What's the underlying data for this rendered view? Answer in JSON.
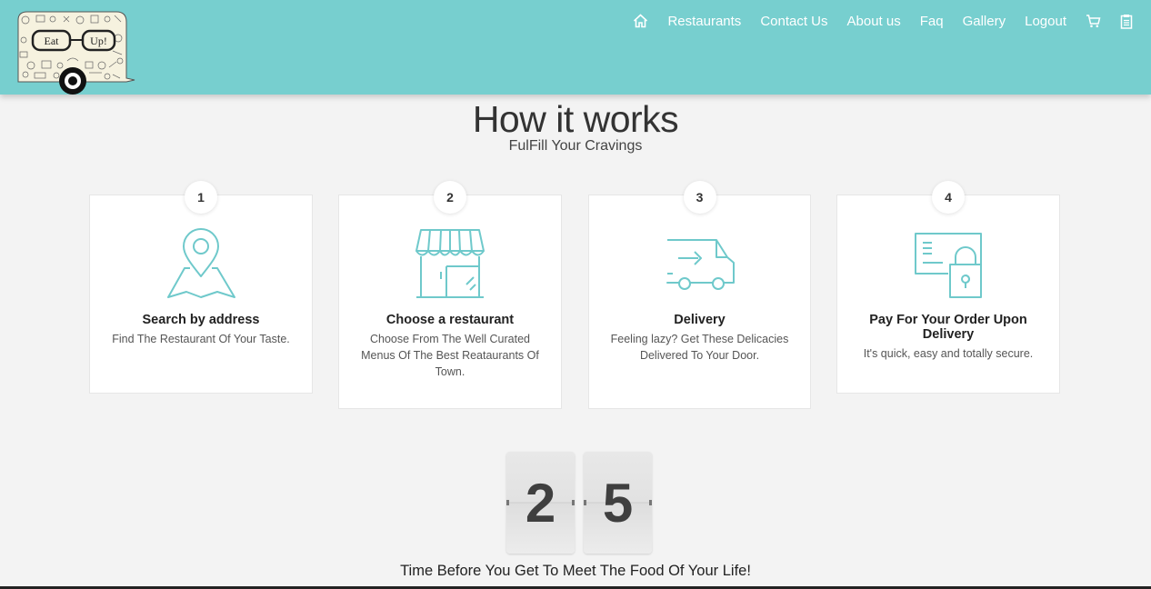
{
  "brand": {
    "logo_word1": "Eat",
    "logo_word2": "Up!"
  },
  "nav": {
    "home_icon": "home-icon",
    "items": [
      "Restaurants",
      "Contact Us",
      "About us",
      "Faq",
      "Gallery",
      "Logout"
    ],
    "cart_icon": "cart-icon",
    "orders_icon": "clipboard-icon"
  },
  "hero": {
    "title": "How it works",
    "subtitle": "FulFill Your Cravings"
  },
  "steps": [
    {
      "number": "1",
      "icon": "map-pin-icon",
      "title": "Search by address",
      "description": "Find The Restaurant Of Your Taste."
    },
    {
      "number": "2",
      "icon": "storefront-icon",
      "title": "Choose a restaurant",
      "description": "Choose From The Well Curated Menus Of The Best Reataurants Of Town."
    },
    {
      "number": "3",
      "icon": "delivery-van-icon",
      "title": "Delivery",
      "description": "Feeling lazy? Get These Delicacies Delivered To Your Door."
    },
    {
      "number": "4",
      "icon": "secure-card-icon",
      "title": "Pay For Your Order Upon Delivery",
      "description": "It's quick, easy and totally secure."
    }
  ],
  "countdown": {
    "digits": [
      "2",
      "5"
    ],
    "caption": "Time Before You Get To Meet The Food Of Your Life!"
  },
  "colors": {
    "header": "#77cfcf",
    "icon_stroke": "#6fc9cb",
    "background": "#f3f3f3"
  }
}
